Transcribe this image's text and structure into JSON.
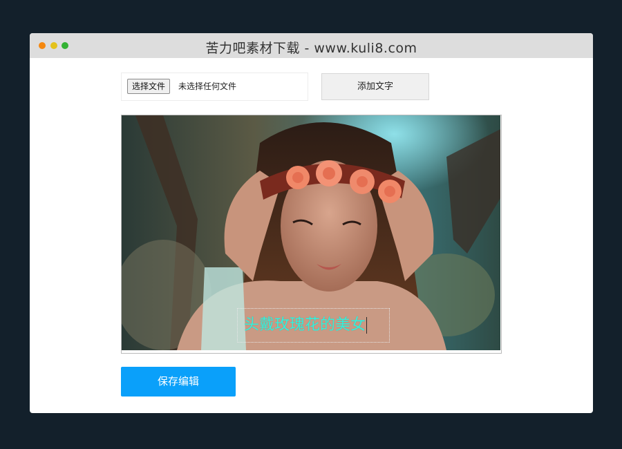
{
  "window": {
    "title": "苦力吧素材下载 - www.kuli8.com",
    "controls": [
      "close-dot",
      "minimize-dot",
      "maximize-dot"
    ]
  },
  "toolbar": {
    "choose_file_label": "选择文件",
    "file_status": "未选择任何文件",
    "add_text_label": "添加文字"
  },
  "canvas": {
    "overlay_text": "头戴玫瑰花的美女",
    "overlay_text_color": "#36f0dc"
  },
  "footer": {
    "save_label": "保存编辑",
    "save_color": "#0aa0fa"
  }
}
